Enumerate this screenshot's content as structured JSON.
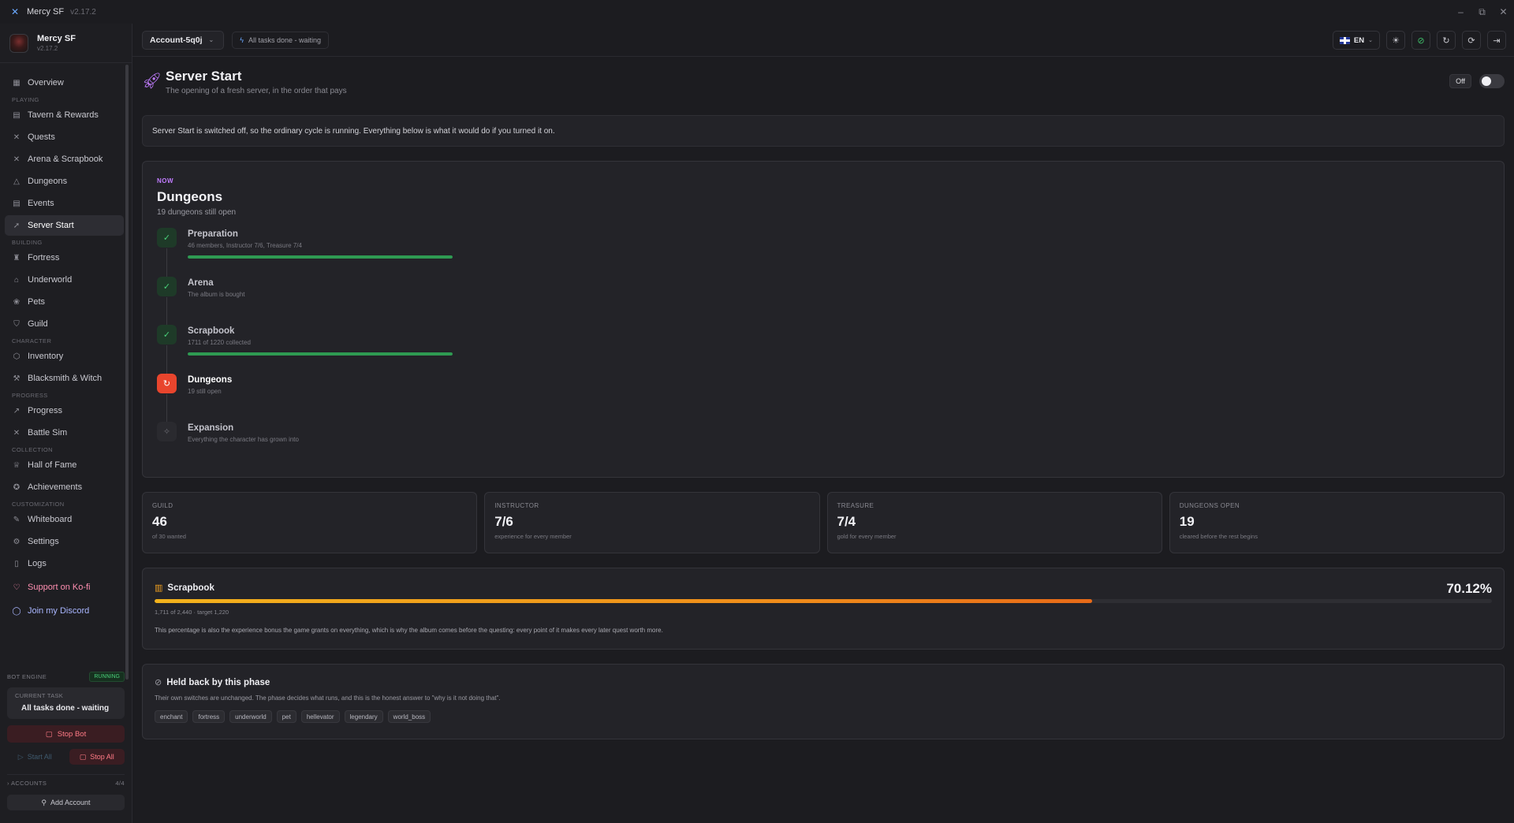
{
  "window": {
    "app_title": "Mercy SF",
    "app_version": "v2.17.2",
    "controls": {
      "minimize": "–",
      "maximize": "⧉",
      "close": "✕"
    }
  },
  "sidebar": {
    "profile": {
      "name": "Mercy SF",
      "version": "v2.17.2"
    },
    "overview": "Overview",
    "sections": {
      "playing": "PLAYING",
      "building": "BUILDING",
      "character": "CHARACTER",
      "progress": "PROGRESS",
      "collection": "COLLECTION",
      "customization": "CUSTOMIZATION"
    },
    "items": {
      "tavern": "Tavern & Rewards",
      "quests": "Quests",
      "arena": "Arena & Scrapbook",
      "dungeons": "Dungeons",
      "events": "Events",
      "server_start": "Server Start",
      "fortress": "Fortress",
      "underworld": "Underworld",
      "pets": "Pets",
      "guild": "Guild",
      "inventory": "Inventory",
      "blacksmith": "Blacksmith & Witch",
      "progress": "Progress",
      "battle_sim": "Battle Sim",
      "hall_of_fame": "Hall of Fame",
      "achievements": "Achievements",
      "whiteboard": "Whiteboard",
      "settings": "Settings",
      "logs": "Logs"
    },
    "links": {
      "kofi": "Support on Ko-fi",
      "discord": "Join my Discord"
    },
    "bot_engine": {
      "label": "BOT ENGINE",
      "status": "RUNNING",
      "current_task_label": "CURRENT TASK",
      "current_task": "All tasks done - waiting",
      "stop_bot": "Stop Bot",
      "start_all": "Start All",
      "stop_all": "Stop All"
    },
    "accounts": {
      "label": "ACCOUNTS",
      "count": "4/4",
      "add": "Add Account"
    }
  },
  "header": {
    "account": "Account-5q0j",
    "status": "All tasks done - waiting",
    "lang": "EN"
  },
  "page": {
    "title": "Server Start",
    "subtitle": "The opening of a fresh server, in the order that pays",
    "toggle_state": "Off",
    "notice": "Server Start is switched off, so the ordinary cycle is running. Everything below is what it would do if you turned it on."
  },
  "phase": {
    "tag": "NOW",
    "title": "Dungeons",
    "subtitle": "19 dungeons still open",
    "steps": [
      {
        "title": "Preparation",
        "desc": "46 members, Instructor 7/6, Treasure 7/4",
        "state": "done",
        "progress": 1.0
      },
      {
        "title": "Arena",
        "desc": "The album is bought",
        "state": "done"
      },
      {
        "title": "Scrapbook",
        "desc": "1711 of 1220 collected",
        "state": "done",
        "progress": 1.0
      },
      {
        "title": "Dungeons",
        "desc": "19 still open",
        "state": "active"
      },
      {
        "title": "Expansion",
        "desc": "Everything the character has grown into",
        "state": "pending"
      }
    ]
  },
  "stats": [
    {
      "label": "GUILD",
      "value": "46",
      "sub": "of 30 wanted"
    },
    {
      "label": "INSTRUCTOR",
      "value": "7/6",
      "sub": "experience for every member"
    },
    {
      "label": "TREASURE",
      "value": "7/4",
      "sub": "gold for every member"
    },
    {
      "label": "DUNGEONS OPEN",
      "value": "19",
      "sub": "cleared before the rest begins"
    }
  ],
  "scrapbook": {
    "title": "Scrapbook",
    "percent": "70.12%",
    "progress": 0.7012,
    "meta": "1,711 of 2,440 · target 1,220",
    "note": "This percentage is also the experience bonus the game grants on everything, which is why the album comes before the questing: every point of it makes every later quest worth more."
  },
  "held_back": {
    "title": "Held back by this phase",
    "desc": "Their own switches are unchanged. The phase decides what runs, and this is the honest answer to \"why is it not doing that\".",
    "chips": [
      "enchant",
      "fortress",
      "underworld",
      "pet",
      "hellevator",
      "legendary",
      "world_boss"
    ]
  },
  "colors": {
    "accent_purple": "#c17cff",
    "success_green": "#4ad17a",
    "active_red": "#e8452d",
    "scrapbook_orange": "#ef8a1a"
  }
}
